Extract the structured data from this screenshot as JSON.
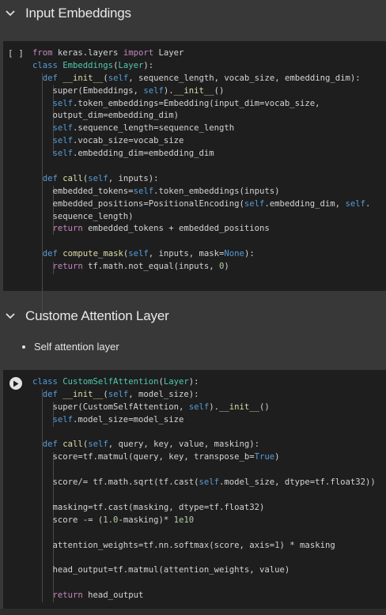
{
  "sections": [
    {
      "title": "Input Embeddings"
    },
    {
      "title": "Custome Attention Layer"
    }
  ],
  "text_cell": {
    "bullet": "Self attention layer"
  },
  "cell1": {
    "gutter": "[ ]",
    "lines": [
      [
        {
          "t": "from",
          "c": "kw2"
        },
        {
          "t": " keras.layers "
        },
        {
          "t": "import",
          "c": "kw2"
        },
        {
          "t": " Layer"
        }
      ],
      [
        {
          "t": "class",
          "c": "kw"
        },
        {
          "t": " "
        },
        {
          "t": "Embeddings",
          "c": "cls"
        },
        {
          "t": "("
        },
        {
          "t": "Layer",
          "c": "cls"
        },
        {
          "t": "):"
        }
      ],
      [
        {
          "t": "  "
        },
        {
          "t": "def",
          "c": "kw"
        },
        {
          "t": " "
        },
        {
          "t": "__init__",
          "c": "fn"
        },
        {
          "t": "("
        },
        {
          "t": "self",
          "c": "kw"
        },
        {
          "t": ", sequence_length, vocab_size, embedding_dim):"
        }
      ],
      [
        {
          "t": "    super(Embeddings, "
        },
        {
          "t": "self",
          "c": "kw"
        },
        {
          "t": ")."
        },
        {
          "t": "__init__",
          "c": "fn"
        },
        {
          "t": "()"
        }
      ],
      [
        {
          "t": "    "
        },
        {
          "t": "self",
          "c": "kw"
        },
        {
          "t": ".token_embeddings=Embedding(input_dim=vocab_size,"
        }
      ],
      [
        {
          "t": "    output_dim=embedding_dim)"
        }
      ],
      [
        {
          "t": "    "
        },
        {
          "t": "self",
          "c": "kw"
        },
        {
          "t": ".sequence_length=sequence_length"
        }
      ],
      [
        {
          "t": "    "
        },
        {
          "t": "self",
          "c": "kw"
        },
        {
          "t": ".vocab_size=vocab_size"
        }
      ],
      [
        {
          "t": "    "
        },
        {
          "t": "self",
          "c": "kw"
        },
        {
          "t": ".embedding_dim=embedding_dim"
        }
      ],
      [
        {
          "t": ""
        }
      ],
      [
        {
          "t": "  "
        },
        {
          "t": "def",
          "c": "kw"
        },
        {
          "t": " "
        },
        {
          "t": "call",
          "c": "fn"
        },
        {
          "t": "("
        },
        {
          "t": "self",
          "c": "kw"
        },
        {
          "t": ", inputs):"
        }
      ],
      [
        {
          "t": "    embedded_tokens="
        },
        {
          "t": "self",
          "c": "kw"
        },
        {
          "t": ".token_embeddings(inputs)"
        }
      ],
      [
        {
          "t": "    embedded_positions=PositionalEncoding("
        },
        {
          "t": "self",
          "c": "kw"
        },
        {
          "t": ".embedding_dim, "
        },
        {
          "t": "self",
          "c": "kw"
        },
        {
          "t": "."
        }
      ],
      [
        {
          "t": "    sequence_length)"
        }
      ],
      [
        {
          "t": "    "
        },
        {
          "t": "return",
          "c": "kw2"
        },
        {
          "t": " embedded_tokens + embedded_positions"
        }
      ],
      [
        {
          "t": ""
        }
      ],
      [
        {
          "t": "  "
        },
        {
          "t": "def",
          "c": "kw"
        },
        {
          "t": " "
        },
        {
          "t": "compute_mask",
          "c": "fn"
        },
        {
          "t": "("
        },
        {
          "t": "self",
          "c": "kw"
        },
        {
          "t": ", inputs, mask="
        },
        {
          "t": "None",
          "c": "kw"
        },
        {
          "t": "):"
        }
      ],
      [
        {
          "t": "    "
        },
        {
          "t": "return",
          "c": "kw2"
        },
        {
          "t": " tf.math.not_equal(inputs, "
        },
        {
          "t": "0",
          "c": "num"
        },
        {
          "t": ")"
        }
      ]
    ]
  },
  "cell2": {
    "lines": [
      [
        {
          "t": "class",
          "c": "kw"
        },
        {
          "t": " "
        },
        {
          "t": "CustomSelfAttention",
          "c": "cls"
        },
        {
          "t": "("
        },
        {
          "t": "Layer",
          "c": "cls"
        },
        {
          "t": "):"
        }
      ],
      [
        {
          "t": "  "
        },
        {
          "t": "def",
          "c": "kw"
        },
        {
          "t": " "
        },
        {
          "t": "__init__",
          "c": "fn"
        },
        {
          "t": "("
        },
        {
          "t": "self",
          "c": "kw"
        },
        {
          "t": ", model_size):"
        }
      ],
      [
        {
          "t": "    super(CustomSelfAttention, "
        },
        {
          "t": "self",
          "c": "kw"
        },
        {
          "t": ")."
        },
        {
          "t": "__init__",
          "c": "fn"
        },
        {
          "t": "()"
        }
      ],
      [
        {
          "t": "    "
        },
        {
          "t": "self",
          "c": "kw"
        },
        {
          "t": ".model_size=model_size"
        }
      ],
      [
        {
          "t": ""
        }
      ],
      [
        {
          "t": "  "
        },
        {
          "t": "def",
          "c": "kw"
        },
        {
          "t": " "
        },
        {
          "t": "call",
          "c": "fn"
        },
        {
          "t": "("
        },
        {
          "t": "self",
          "c": "kw"
        },
        {
          "t": ", query, key, value, masking):"
        }
      ],
      [
        {
          "t": "    score=tf.matmul(query, key, transpose_b="
        },
        {
          "t": "True",
          "c": "kw"
        },
        {
          "t": ")"
        }
      ],
      [
        {
          "t": ""
        }
      ],
      [
        {
          "t": "    score/= tf.math.sqrt(tf.cast("
        },
        {
          "t": "self",
          "c": "kw"
        },
        {
          "t": ".model_size, dtype=tf.float32))"
        }
      ],
      [
        {
          "t": ""
        }
      ],
      [
        {
          "t": "    masking=tf.cast(masking, dtype=tf.float32)"
        }
      ],
      [
        {
          "t": "    score -= ("
        },
        {
          "t": "1.0",
          "c": "num"
        },
        {
          "t": "-masking)* "
        },
        {
          "t": "1e10",
          "c": "num"
        }
      ],
      [
        {
          "t": ""
        }
      ],
      [
        {
          "t": "    attention_weights=tf.nn.softmax(score, axis="
        },
        {
          "t": "1",
          "c": "num"
        },
        {
          "t": ") * masking"
        }
      ],
      [
        {
          "t": ""
        }
      ],
      [
        {
          "t": "    head_output=tf.matmul(attention_weights, value)"
        }
      ],
      [
        {
          "t": ""
        }
      ],
      [
        {
          "t": "    "
        },
        {
          "t": "return",
          "c": "kw2"
        },
        {
          "t": " head_output"
        }
      ]
    ]
  }
}
